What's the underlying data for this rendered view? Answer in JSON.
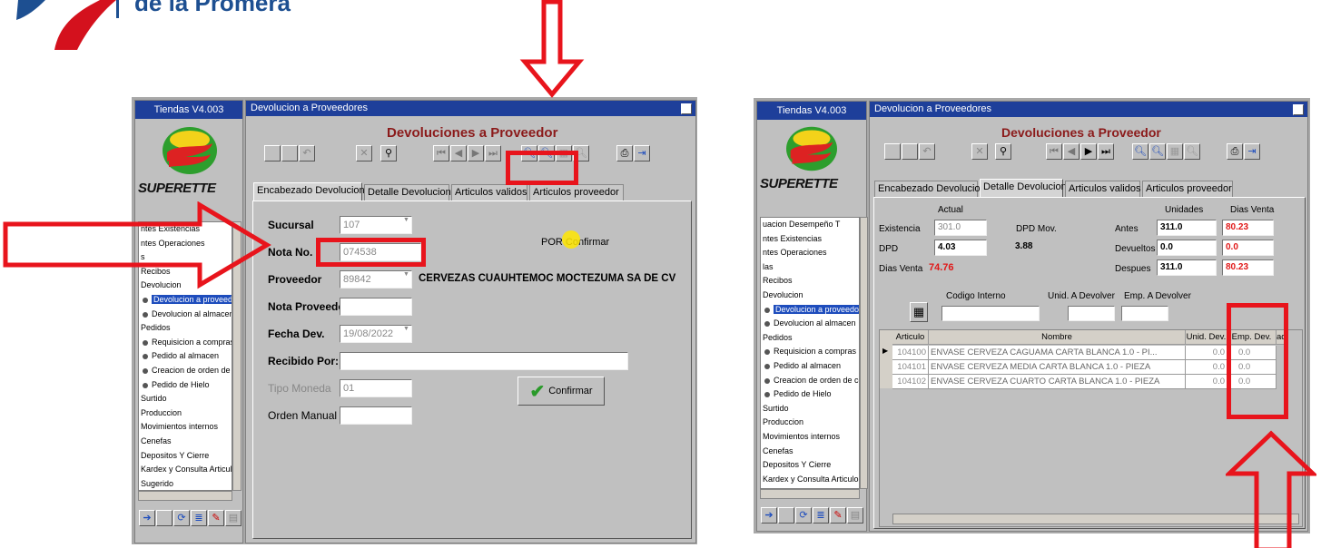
{
  "logo": {
    "text": "de la Promera"
  },
  "left_window": {
    "sidebar_title": "Tiendas V4.003",
    "brand": "SUPERETTE",
    "window_title": "Devolucion a Proveedores",
    "form_title": "Devoluciones a Proveedor",
    "tabs": [
      "Encabezado Devolucion",
      "Detalle Devolucion",
      "Articulos validos",
      "Articulos proveedor"
    ],
    "menu": [
      {
        "label": "ntes Existencias",
        "sub": false
      },
      {
        "label": "ntes Operaciones",
        "sub": false
      },
      {
        "label": "s",
        "sub": false
      },
      {
        "label": "Recibos",
        "sub": false
      },
      {
        "label": "Devolucion",
        "sub": false
      },
      {
        "label": "Devolucion a proveedor",
        "sub": true,
        "selected": true
      },
      {
        "label": "Devolucion al almacen",
        "sub": true
      },
      {
        "label": "Pedidos",
        "sub": false
      },
      {
        "label": "Requisicion a compras",
        "sub": true
      },
      {
        "label": "Pedido al almacen",
        "sub": true
      },
      {
        "label": "Creacion de orden de co",
        "sub": true
      },
      {
        "label": "Pedido de Hielo",
        "sub": true
      },
      {
        "label": "Surtido",
        "sub": false
      },
      {
        "label": "Produccion",
        "sub": false
      },
      {
        "label": "Movimientos internos",
        "sub": false
      },
      {
        "label": "Cenefas",
        "sub": false
      },
      {
        "label": "Depositos Y Cierre",
        "sub": false
      },
      {
        "label": "Kardex y Consulta Articulos",
        "sub": false
      },
      {
        "label": "Sugerido",
        "sub": false
      }
    ],
    "fields": {
      "sucursal_label": "Sucursal",
      "sucursal_value": "107",
      "nota_label": "Nota No.",
      "nota_value": "074538",
      "status_text": "POR Confirmar",
      "proveedor_label": "Proveedor",
      "proveedor_value": "89842",
      "proveedor_name": "CERVEZAS CUAUHTEMOC MOCTEZUMA SA DE CV",
      "nota_prov_label": "Nota Proveedor",
      "nota_prov_value": "",
      "fecha_label": "Fecha Dev.",
      "fecha_value": "19/08/2022",
      "recibido_label": "Recibido Por:",
      "recibido_value": "",
      "moneda_label": "Tipo Moneda",
      "moneda_value": "01",
      "orden_label": "Orden Manual",
      "orden_value": "",
      "confirm_button": "Confirmar"
    }
  },
  "right_window": {
    "sidebar_title": "Tiendas V4.003",
    "brand": "SUPERETTE",
    "window_title": "Devolucion a Proveedores",
    "form_title": "Devoluciones a Proveedor",
    "tabs": [
      "Encabezado Devolucion",
      "Detalle Devolucion",
      "Articulos validos",
      "Articulos proveedor"
    ],
    "menu": [
      {
        "label": "uacion Desempeño T",
        "sub": false
      },
      {
        "label": "ntes Existencias",
        "sub": false
      },
      {
        "label": "ntes Operaciones",
        "sub": false
      },
      {
        "label": "las",
        "sub": false
      },
      {
        "label": "Recibos",
        "sub": false
      },
      {
        "label": "Devolucion",
        "sub": false
      },
      {
        "label": "Devolucion a proveedor",
        "sub": true,
        "selected": true
      },
      {
        "label": "Devolucion al almacen",
        "sub": true
      },
      {
        "label": "Pedidos",
        "sub": false
      },
      {
        "label": "Requisicion a compras",
        "sub": true
      },
      {
        "label": "Pedido al almacen",
        "sub": true
      },
      {
        "label": "Creacion de orden de cor",
        "sub": true
      },
      {
        "label": "Pedido de Hielo",
        "sub": true
      },
      {
        "label": "Surtido",
        "sub": false
      },
      {
        "label": "Produccion",
        "sub": false
      },
      {
        "label": "Movimientos internos",
        "sub": false
      },
      {
        "label": "Cenefas",
        "sub": false
      },
      {
        "label": "Depositos Y Cierre",
        "sub": false
      },
      {
        "label": "Kardex y Consulta Articulos",
        "sub": false
      },
      {
        "label": "Sugerido",
        "sub": false
      }
    ],
    "stats": {
      "actual_hdr": "Actual",
      "unidades_hdr": "Unidades",
      "dias_venta_hdr": "Dias Venta",
      "existencia_label": "Existencia",
      "existencia_value": "301.0",
      "dpd_mov_label": "DPD Mov.",
      "antes_label": "Antes",
      "antes_value": "311.0",
      "antes_dias": "80.23",
      "dpd_label": "DPD",
      "dpd_value": "4.03",
      "dpd_mov_value": "3.88",
      "devueltos_label": "Devueltos",
      "devueltos_value": "0.0",
      "devueltos_dias": "0.0",
      "dias_venta_label": "Dias Venta",
      "dias_venta_value": "74.76",
      "despues_label": "Despues",
      "despues_value": "311.0",
      "despues_dias": "80.23"
    },
    "entry": {
      "codigo_label": "Codigo Interno",
      "unid_label": "Unid. A Devolver",
      "emp_label": "Emp. A Devolver"
    },
    "grid": {
      "headers": [
        "Articulo",
        "Nombre",
        "Unid. Dev.",
        "Emp. Dev.",
        "ad"
      ],
      "rows": [
        [
          "104100",
          "ENVASE  CERVEZA CAGUAMA  CARTA BLANCA 1.0 - PI...",
          "0.0",
          "0.0"
        ],
        [
          "104101",
          "ENVASE  CERVEZA MEDIA  CARTA BLANCA  1.0 - PIEZA",
          "0.0",
          "0.0"
        ],
        [
          "104102",
          "ENVASE  CERVEZA CUARTO  CARTA BLANCA 1.0 - PIEZA",
          "0.0",
          "0.0"
        ]
      ]
    }
  },
  "colors": {
    "title_blue": "#1e3f9a",
    "form_title_red": "#8b1a1a",
    "annotation_red": "#e8141c",
    "highlight_red": "#e8141c"
  }
}
